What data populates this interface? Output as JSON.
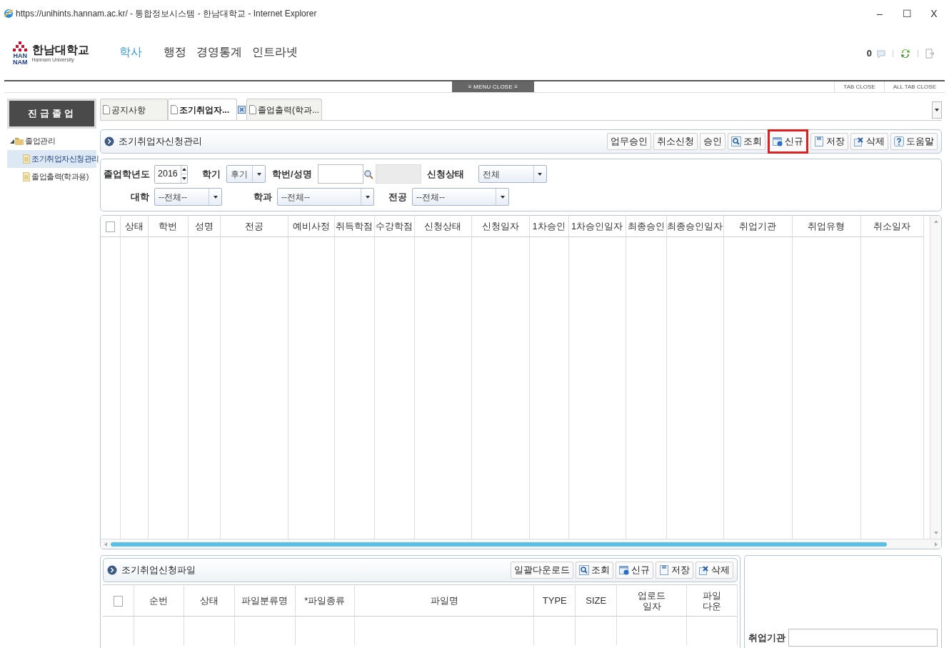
{
  "window": {
    "title": "https://unihints.hannam.ac.kr/ - 통합정보시스템 - 한남대학교 - Internet Explorer",
    "controls": [
      "–",
      "☐",
      "X"
    ]
  },
  "header": {
    "logo_name": "한남대학교",
    "logo_mark_top": "HAN",
    "logo_mark_bottom": "NAM",
    "logo_sub": "Hannam University",
    "nav": [
      {
        "label": "학사",
        "selected": true
      },
      {
        "label": "행정",
        "selected": false
      },
      {
        "label": "경영통계",
        "selected": false
      },
      {
        "label": "인트라넷",
        "selected": false
      }
    ],
    "message_count": "0"
  },
  "menu_bar": {
    "menu_close": "≡ MENU CLOSE ≡",
    "tab_close": "TAB CLOSE",
    "all_tab_close": "ALL TAB CLOSE"
  },
  "sidebar": {
    "title": "진급졸업",
    "tree": [
      {
        "label": "졸업관리",
        "expanded": true,
        "selected": false,
        "children": [
          {
            "label": "조기취업자신청관리",
            "selected": true
          },
          {
            "label": "졸업출력(학과용)",
            "selected": false
          }
        ]
      }
    ]
  },
  "tabs": [
    {
      "label": "공지사항",
      "selected": false
    },
    {
      "label": "조기취업자...",
      "selected": true
    },
    {
      "label": "졸업출력(학과...",
      "selected": false
    }
  ],
  "panel": {
    "title": "조기취업자신청관리",
    "buttons": [
      {
        "label": "업무승인",
        "kind": "plain",
        "highlighted": false
      },
      {
        "label": "취소신청",
        "kind": "plain",
        "highlighted": false
      },
      {
        "label": "승인",
        "kind": "plain",
        "highlighted": false
      },
      {
        "label": "조회",
        "kind": "search",
        "highlighted": false
      },
      {
        "label": "신규",
        "kind": "new",
        "highlighted": true
      },
      {
        "label": "저장",
        "kind": "save",
        "highlighted": false
      },
      {
        "label": "삭제",
        "kind": "delete",
        "highlighted": false
      },
      {
        "label": "도움말",
        "kind": "help",
        "highlighted": false
      }
    ]
  },
  "filters": {
    "year": {
      "label": "졸업학년도",
      "value": "2016"
    },
    "term": {
      "label": "학기",
      "value": "후기"
    },
    "student": {
      "label": "학번/성명"
    },
    "status": {
      "label": "신청상태",
      "value": "전체"
    },
    "college": {
      "label": "대학",
      "value": "--전체--"
    },
    "dept": {
      "label": "학과",
      "value": "--전체--"
    },
    "major": {
      "label": "전공",
      "value": "--전체--"
    }
  },
  "table": {
    "columns": [
      "상태",
      "학번",
      "성명",
      "전공",
      "예비사정",
      "취득학점",
      "수강학점",
      "신청상태",
      "신청일자",
      "1차승인",
      "1차승인일자",
      "최종승인",
      "최종승인일자",
      "취업기관",
      "취업유형",
      "취소일자"
    ],
    "all_checked": false
  },
  "file_panel": {
    "title": "조기취업신청파일",
    "buttons": [
      {
        "label": "일괄다운로드",
        "kind": "plain"
      },
      {
        "label": "조회",
        "kind": "search"
      },
      {
        "label": "신규",
        "kind": "new"
      },
      {
        "label": "저장",
        "kind": "save"
      },
      {
        "label": "삭제",
        "kind": "delete"
      }
    ],
    "columns": [
      "순번",
      "상태",
      "파일분류명",
      "*파일종류",
      "파일명",
      "TYPE",
      "SIZE",
      "업로드\n일자",
      "파일\n다운"
    ],
    "all_checked": false
  },
  "side_form": {
    "label": "취업기관"
  }
}
